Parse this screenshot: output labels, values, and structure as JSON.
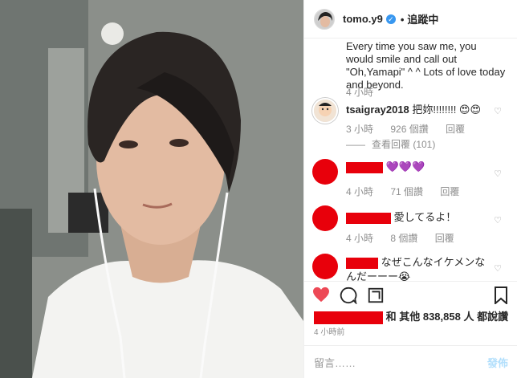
{
  "header": {
    "username": "tomo.y9",
    "follow_label": "追蹤中",
    "dot": "•"
  },
  "caption": {
    "text": "Every time you saw me, you would smile and call out \"Oh,Yamapi\" ^ ^ Lots of love today and beyond.",
    "time": "4 小時"
  },
  "comments": [
    {
      "username": "tsaigray2018",
      "text": "把妳!!!!!!!! 😍😍",
      "time": "3 小時",
      "likes": "926 個讚",
      "reply": "回覆",
      "view_replies": "查看回覆 (101)"
    },
    {
      "text": "💜💜💜",
      "time": "4 小時",
      "likes": "71 個讚",
      "reply": "回覆"
    },
    {
      "text": "愛してるよ！",
      "time": "4 小時",
      "likes": "8 個讚",
      "reply": "回覆"
    },
    {
      "text": "なぜこんなイケメンなんだーーー😭"
    }
  ],
  "likes_line": {
    "prefix": "和 其他 838,858 人 都說讚"
  },
  "post_time": "4 小時前",
  "composer": {
    "placeholder": "留言……",
    "post_label": "發佈"
  },
  "colors": {
    "redaction": "#e8000b",
    "verified": "#3897f0",
    "like_heart": "#ed4956"
  },
  "icons": [
    "heart-icon",
    "comment-icon",
    "share-icon",
    "bookmark-icon",
    "verified-badge-icon"
  ]
}
